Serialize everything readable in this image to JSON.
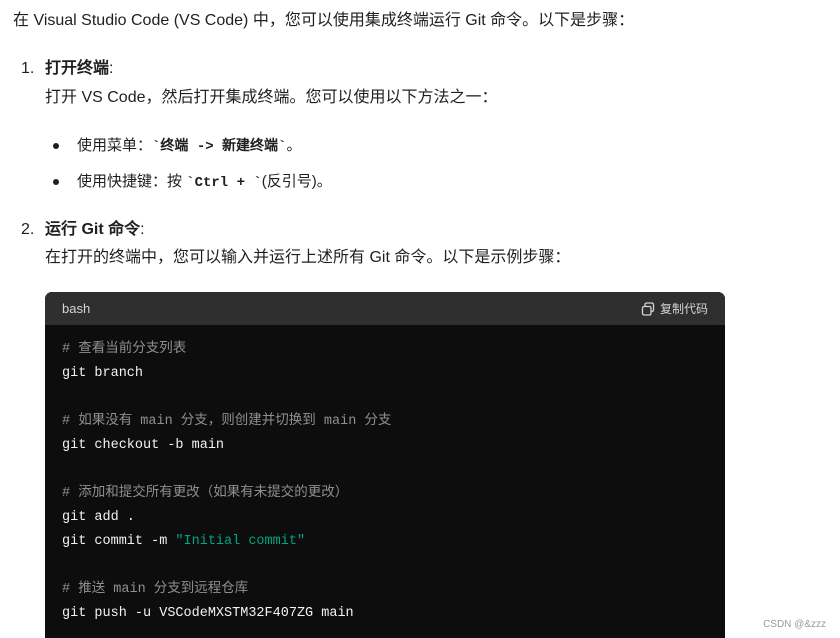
{
  "intro": "在 Visual Studio Code (VS Code) 中，您可以使用集成终端运行 Git 命令。以下是步骤：",
  "steps": [
    {
      "number": "1.",
      "title": "打开终端",
      "colon": ":",
      "desc": "打开 VS Code，然后打开集成终端。您可以使用以下方法之一：",
      "bullets": [
        {
          "prefix": "使用菜单：",
          "code": "`终端 -> 新建终端`",
          "suffix": "。"
        },
        {
          "prefix": "使用快捷键：按 ",
          "code": "`Ctrl + `",
          "suffix": "(反引号)。"
        }
      ]
    },
    {
      "number": "2.",
      "title": "运行 Git 命令",
      "colon": ":",
      "desc": "在打开的终端中，您可以输入并运行上述所有 Git 命令。以下是示例步骤："
    }
  ],
  "codeblock": {
    "language": "bash",
    "copy_label": "复制代码",
    "lines": [
      {
        "type": "comment",
        "text": "# 查看当前分支列表"
      },
      {
        "type": "code",
        "text": "git branch"
      },
      {
        "type": "comment",
        "text": "# 如果没有 main 分支，则创建并切换到 main 分支"
      },
      {
        "type": "code",
        "text": "git checkout -b main"
      },
      {
        "type": "comment",
        "text": "# 添加和提交所有更改（如果有未提交的更改）"
      },
      {
        "type": "code",
        "text": "git add ."
      },
      {
        "type": "code_str",
        "text": "git commit -m ",
        "str": "\"Initial commit\""
      },
      {
        "type": "comment",
        "text": "# 推送 main 分支到远程仓库"
      },
      {
        "type": "code",
        "text": "git push -u VSCodeMXSTM32F407ZG main"
      }
    ]
  },
  "watermark": "CSDN @&zzz"
}
